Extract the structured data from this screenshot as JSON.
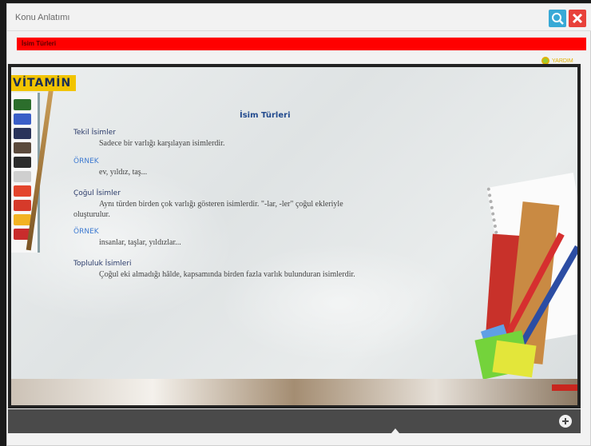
{
  "window": {
    "title": "Konu Anlatımı",
    "zoom_icon": "zoom-in-icon",
    "close_icon": "close-icon"
  },
  "redbar": {
    "label": "İsim Türleri"
  },
  "help": {
    "label": "YARDIM",
    "icon": "help-circle-icon"
  },
  "brand": {
    "logo": "VİTAMİN"
  },
  "lesson": {
    "title": "İsim Türleri",
    "sections": [
      {
        "heading": "Tekil İsimler",
        "text": "Sadece bir varlığı karşılayan isimlerdir.",
        "example_label": "ÖRNEK",
        "example": "ev, yıldız, taş..."
      },
      {
        "heading": "Çoğul İsimler",
        "text_line1": "Aynı türden birden çok varlığı gösteren isimlerdir. \"-lar, -ler\" çoğul ekleriyle",
        "text_line2": "oluşturulur.",
        "example_label": "ÖRNEK",
        "example": "insanlar, taşlar, yıldızlar..."
      },
      {
        "heading": "Topluluk İsimleri",
        "text": "Çoğul eki almadığı hâlde, kapsamında birden fazla varlık bulunduran isimlerdir."
      }
    ]
  },
  "bottom": {
    "plus_icon": "plus-circle-icon",
    "scroll_icon": "up-arrow-icon"
  },
  "colors": {
    "accent_blue": "#38a9d6",
    "close_red": "#e8413a",
    "banner_red": "#ff0000",
    "title_blue": "#224a8e"
  }
}
